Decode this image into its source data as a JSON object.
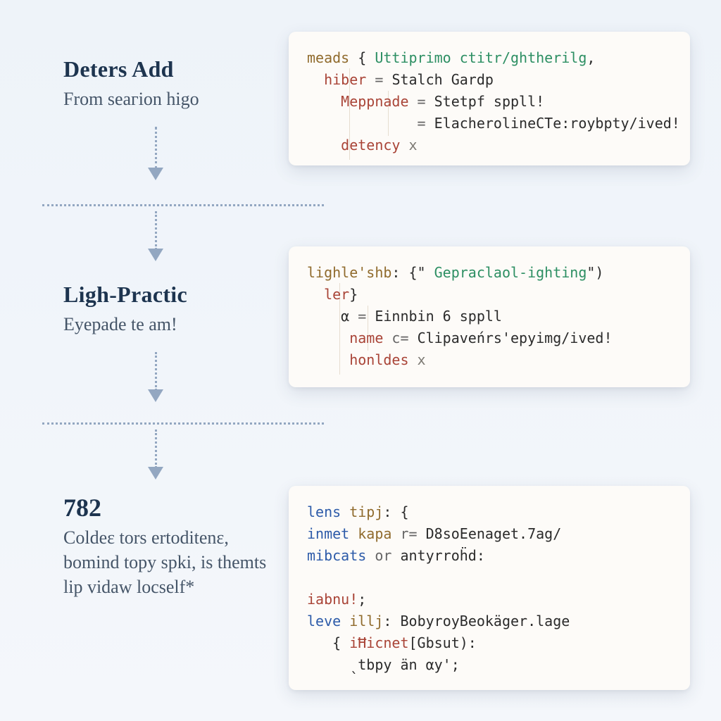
{
  "sections": [
    {
      "title": "Deters Add",
      "body": "From seaгion higo"
    },
    {
      "title": "Ligh-Practic",
      "body": "Eyepade te am!"
    },
    {
      "num": "782",
      "body": "Coldeɛ tors ertoditenɛ, bomind topy spki, is themts lip vidaw locself*"
    }
  ],
  "code1": {
    "l1": {
      "kw": "meads",
      "brace": " { ",
      "str": "Uttiprimo ctitr/ghtherilg",
      "comma": ","
    },
    "l2": {
      "id": "hiber",
      "eq": " = ",
      "rest": "Stalch Gardp"
    },
    "l3": {
      "id": "Meppnade",
      "eq": " = ",
      "rest": "Stetpf sppll!"
    },
    "l4": {
      "eq": "= ",
      "rest": "ElacherolineCTe:roybpty/ived!"
    },
    "l5": {
      "id": "detency",
      "x": " x"
    }
  },
  "code2": {
    "l1": {
      "kw": "lighle'shb",
      "colon": ": {",
      "q1": "\" ",
      "str": "Gepraclaol-ighting",
      "q2": "\")"
    },
    "l2": {
      "id": "ler",
      "brace": "}"
    },
    "l3": {
      "a": "α",
      "eq": " = ",
      "rest": "Einnbin 6 sppll"
    },
    "l4": {
      "id": "name",
      "eq": " c= ",
      "rest": "Clipaveńrs'epyimg/ived!"
    },
    "l5": {
      "id": "honldes",
      "x": " x"
    }
  },
  "code3": {
    "l1": {
      "kw": "lens",
      "id": " tipj",
      "colon": ": {"
    },
    "l2": {
      "kw": "inmet",
      "id": " kapa",
      "eq": " r= ",
      "rest": "D8soEenaget.7ag/"
    },
    "l3": {
      "kw": "mibcats",
      "op": " or ",
      "rest": "antyrroḧd:"
    },
    "l4": {
      "id": "iabnu!",
      "semi": ";"
    },
    "l5": {
      "kw": "leve",
      "id": " illj",
      "colon": ": ",
      "rest": "BobyroyBeokäger.lage"
    },
    "l6": {
      "open": "{ ",
      "id": "iĦicnet",
      "arg": "[Gbsut):"
    },
    "l7": {
      "pre": "  ˎtbpy än αy';"
    }
  }
}
